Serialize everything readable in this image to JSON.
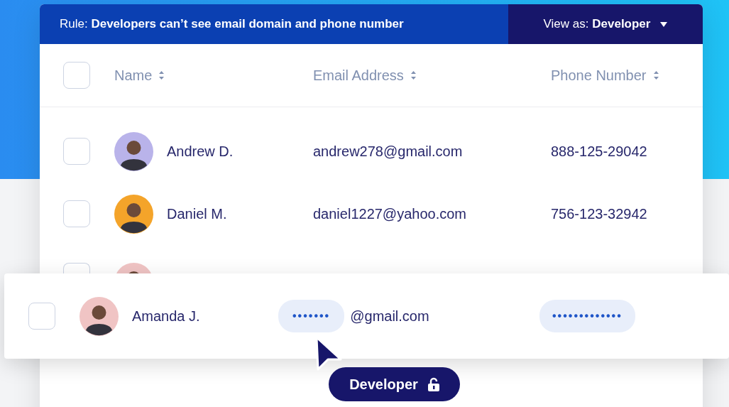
{
  "rule_bar": {
    "rule": "Rule: **Developers can’t see email domain and phone number**",
    "view_as": "View as: **Developer**"
  },
  "table": {
    "select_all": {
      "checked": false
    },
    "columns": [
      {
        "label": "Name"
      },
      {
        "label": "Email Address"
      },
      {
        "label": "Phone Number"
      }
    ],
    "rows": [
      {
        "checked": false,
        "color": "#b9b3ea",
        "name": "Andrew D.",
        "email": "andrew278@gmail.com",
        "phone": "888-125-29042"
      },
      {
        "checked": false,
        "color": "#f4a42a",
        "name": "Daniel M.",
        "email": "daniel1227@yahoo.com",
        "phone": "756-123-32942"
      }
    ],
    "hidden_row": {
      "checked": false,
      "color": "#f0c4c4"
    }
  },
  "masked_row": {
    "checked": false,
    "color": "#f0c4c4",
    "name": "Amanda J.",
    "email_mask": "•••••••",
    "email_domain": "@gmail.com",
    "phone_mask": "•••••••••••••"
  },
  "cursor_tag": {
    "label": "Developer"
  }
}
